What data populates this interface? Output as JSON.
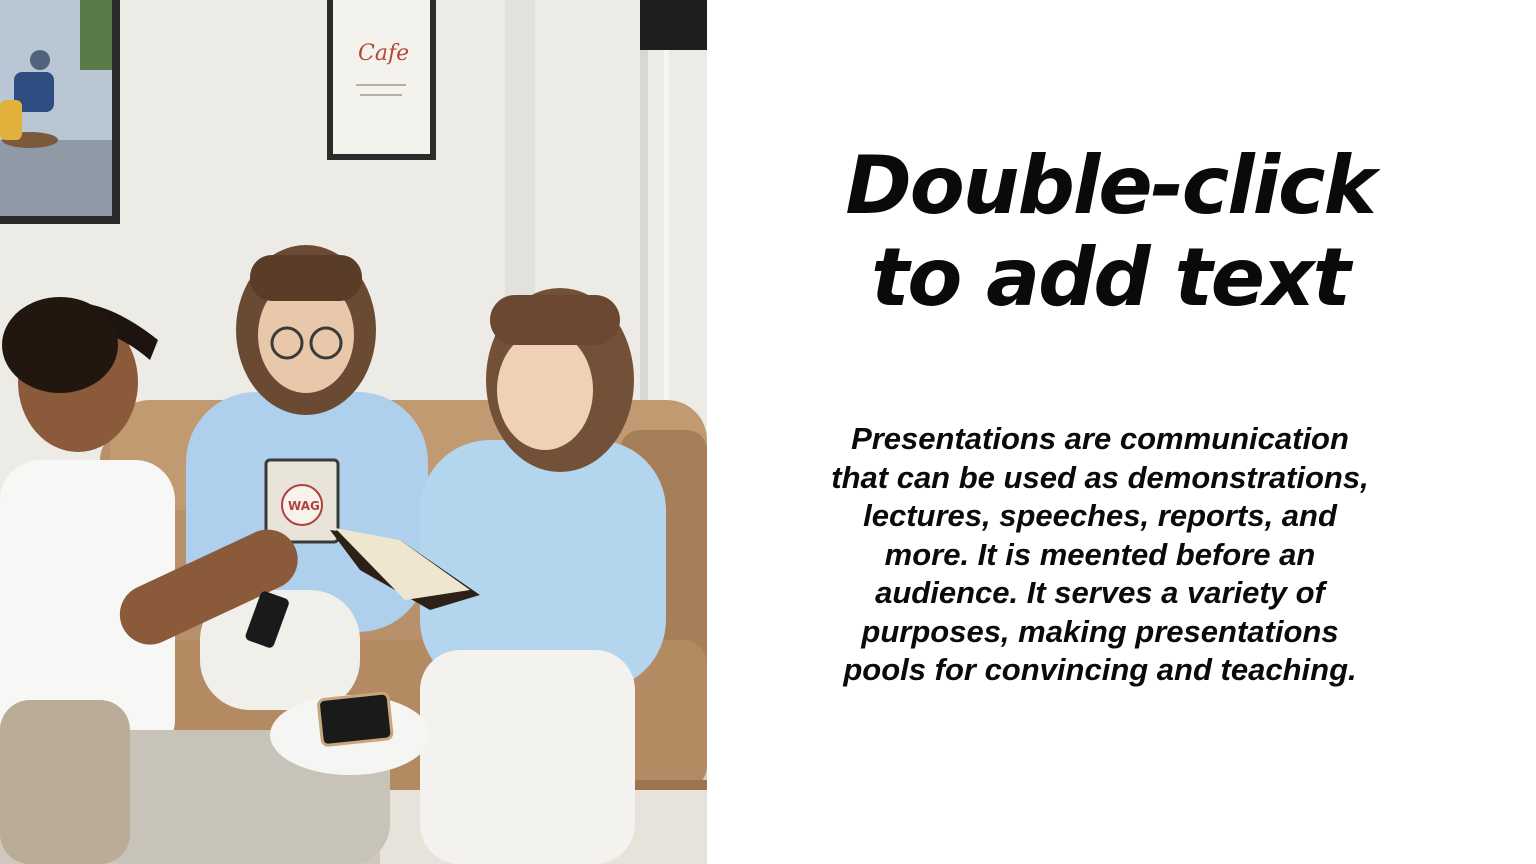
{
  "slide": {
    "title_line1": "Double-click",
    "title_line2": "to add text",
    "body_lines": [
      "Presentations are communication",
      "that can be used as demonstrations,",
      "lectures, speeches, reports, and",
      "more. It is meented before an",
      "audience. It serves a variety of",
      "purposes, making presentations",
      "pools for convincing and teaching."
    ]
  },
  "photo": {
    "icon": "photo-image",
    "poster_text": "Cafe",
    "book_cover_text": "WAG"
  },
  "colors": {
    "background": "#ffffff",
    "text": "#0a0a0a",
    "sweater_blue": "#aed0ec",
    "sofa_tan": "#c29a72",
    "wall": "#ecebe6"
  }
}
